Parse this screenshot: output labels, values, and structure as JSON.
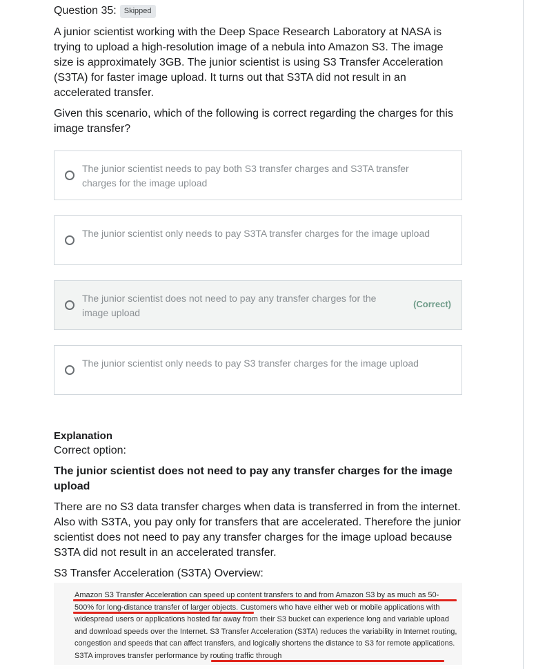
{
  "question": {
    "title": "Question 35:",
    "status_badge": "Skipped",
    "paragraph1": "A junior scientist working with the Deep Space Research Laboratory at NASA is trying to upload a high-resolution image of a nebula into Amazon S3. The image size is approximately 3GB. The junior scientist is using S3 Transfer Acceleration (S3TA) for faster image upload. It turns out that S3TA did not result in an accelerated transfer.",
    "paragraph2": "Given this scenario, which of the following is correct regarding the charges for this image transfer?"
  },
  "options": [
    {
      "text": "The junior scientist needs to pay both S3 transfer charges and S3TA transfer charges for the image upload",
      "correct": false
    },
    {
      "text": "The junior scientist only needs to pay S3TA transfer charges for the image upload",
      "correct": false
    },
    {
      "text": "The junior scientist does not need to pay any transfer charges for the image upload",
      "correct": true,
      "correct_label": "(Correct)"
    },
    {
      "text": "The junior scientist only needs to pay S3 transfer charges for the image upload",
      "correct": false
    }
  ],
  "explanation": {
    "heading": "Explanation",
    "correct_option_label": "Correct option:",
    "answer": "The junior scientist does not need to pay any transfer charges for the image upload",
    "body": "There are no S3 data transfer charges when data is transferred in from the internet. Also with S3TA, you pay only for transfers that are accelerated. Therefore the junior scientist does not need to pay any transfer charges for the image upload because S3TA did not result in an accelerated transfer.",
    "overview_label": "S3 Transfer Acceleration (S3TA) Overview:",
    "figure_text": "Amazon S3 Transfer Acceleration can speed up content transfers to and from Amazon S3 by as much as 50-500% for long-distance transfer of larger objects. Customers who have either web or mobile applications with widespread users or applications hosted far away from their S3 bucket can experience long and variable upload and download speeds over the Internet. S3 Transfer Acceleration (S3TA) reduces the variability in Internet routing, congestion and speeds that can affect transfers, and logically shortens the distance to S3 for remote applications. S3TA improves transfer performance by routing traffic through"
  },
  "colors": {
    "correct_tag": "#6f9c89",
    "underline": "#e0241c",
    "option_border": "#d1d7dc",
    "correct_bg": "#f2f4f3"
  }
}
